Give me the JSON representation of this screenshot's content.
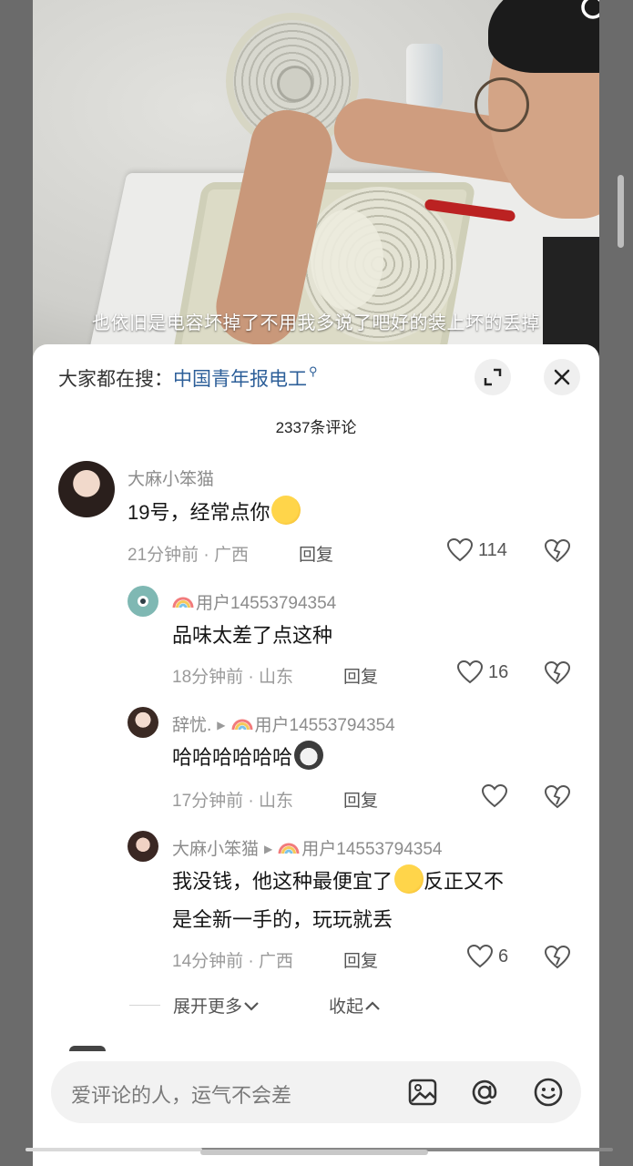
{
  "video": {
    "subtitle": "也依旧是电容坏掉了不用我多说了吧好的装上坏的丢掉",
    "progress": 0.3
  },
  "sheet": {
    "hot_search_prefix": "大家都在搜：",
    "hot_search_keyword": "中国青年报电工",
    "comment_count": "2337条评论"
  },
  "comments": [
    {
      "user": "大麻小笨猫",
      "text": "19号，经常点你",
      "time_location": "21分钟前 · 广西",
      "reply_label": "回复",
      "likes": "114"
    }
  ],
  "replies": [
    {
      "user": "用户14553794354",
      "text": "品味太差了点这种",
      "time_location": "18分钟前 · 山东",
      "reply_label": "回复",
      "likes": "16"
    },
    {
      "user": "辞忧.",
      "reply_to": "用户14553794354",
      "text": "哈哈哈哈哈哈",
      "time_location": "17分钟前 · 山东",
      "reply_label": "回复",
      "likes": ""
    },
    {
      "user": "大麻小笨猫",
      "reply_to": "用户14553794354",
      "text_line1_a": "我没钱，他这种最便宜了",
      "text_line1_b": "反正又不",
      "text_line2": "是全新一手的，玩玩就丢",
      "time_location": "14分钟前 · 广西",
      "reply_label": "回复",
      "likes": "6"
    }
  ],
  "thread_controls": {
    "expand_more": "展开更多",
    "collapse": "收起"
  },
  "input": {
    "placeholder": "爱评论的人，运气不会差"
  },
  "icons": [
    "search-icon",
    "expand-icon",
    "close-icon",
    "heart-icon",
    "dislike-icon",
    "image-icon",
    "at-icon",
    "emoji-icon"
  ]
}
